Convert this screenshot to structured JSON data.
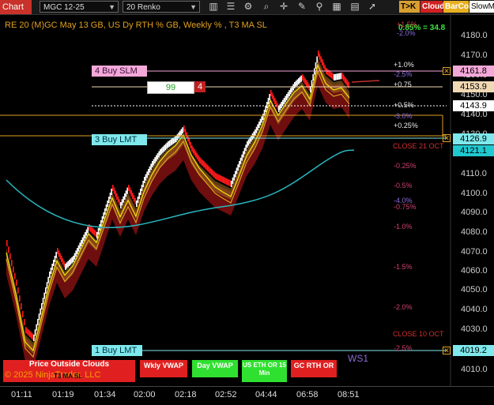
{
  "toolbar": {
    "tab_label": "Chart",
    "instrument": "MGC 12-25",
    "bar_type": "20 Renko",
    "tk_label": "T>K",
    "cloud_label": "Cloud",
    "barcol_label": "BarCol",
    "slowma_label": "SlowM",
    "icons": [
      "bar-chart-icon",
      "list-icon",
      "indicator-icon",
      "zoom-icon",
      "crosshair-icon",
      "plus-icon",
      "pencil-icon",
      "search-icon",
      "layout-icon"
    ]
  },
  "chart": {
    "title": "RE 20  (M)GC May 13 GB, US Dy RTH % GB, Weekly % , T3 MA SL",
    "stat_top": "0.85% = 34.8",
    "y_ticks": [
      "4180.0",
      "4170.0",
      "4160.0",
      "4150.0",
      "4140.0",
      "4130.0",
      "4120.0",
      "4110.0",
      "4100.0",
      "4090.0",
      "4080.0",
      "4070.0",
      "4060.0",
      "4050.0",
      "4040.0",
      "4030.0",
      "4020.0",
      "4010.0"
    ],
    "x_ticks": [
      "01:11",
      "01:19",
      "01:34",
      "02:00",
      "02:18",
      "02:52",
      "04:44",
      "06:58",
      "08:51"
    ],
    "price_boxes": [
      {
        "value": "4161.8",
        "bg": "#f4a8d8",
        "fg": "#000"
      },
      {
        "value": "4153.9",
        "bg": "#f1d9b5",
        "fg": "#000"
      },
      {
        "value": "4143.9",
        "bg": "#ffffff",
        "fg": "#000"
      },
      {
        "value": "4126.9",
        "bg": "#7ee8ec",
        "fg": "#000"
      },
      {
        "value": "4121.1",
        "bg": "#20c8d0",
        "fg": "#000"
      },
      {
        "value": "4019.2",
        "bg": "#7ee8ec",
        "fg": "#000"
      }
    ],
    "orders": {
      "buy_slm": "4 Buy SLM",
      "buy_lmt": "3 Buy LMT",
      "buy_lmt1": "1 Buy LMT",
      "qty_green": "99",
      "qty_red": "4"
    },
    "pct_labels": [
      {
        "text": "+1.5%",
        "color": "#d04040"
      },
      {
        "text": "-2.0%",
        "color": "#8a6ad8"
      },
      {
        "text": "+1.0%",
        "color": "#e8e8e8"
      },
      {
        "text": "-2.5%",
        "color": "#8a6ad8"
      },
      {
        "text": "+0.75",
        "color": "#e8e8e8"
      },
      {
        "text": "+0.5%",
        "color": "#e8e8e8"
      },
      {
        "text": "-3.0%",
        "color": "#8a6ad8"
      },
      {
        "text": "+0.25%",
        "color": "#e8e8e8"
      },
      {
        "text": "CLOSE 21 OCT",
        "color": "#d03030"
      },
      {
        "text": "-0.25%",
        "color": "#d04070"
      },
      {
        "text": "-0.5%",
        "color": "#d04070"
      },
      {
        "text": "-4.0%",
        "color": "#8a6ad8"
      },
      {
        "text": "-0.75%",
        "color": "#d04070"
      },
      {
        "text": "-1.0%",
        "color": "#d04070"
      },
      {
        "text": "-1.5%",
        "color": "#d04070"
      },
      {
        "text": "-2.0%",
        "color": "#d04070"
      },
      {
        "text": "CLOSE 10 OCT",
        "color": "#d03030"
      },
      {
        "text": "-2.5%",
        "color": "#d04070"
      }
    ],
    "ws_label": "WS1",
    "copyright": "© 2025 NinjaTrader, LLC"
  },
  "indicators": {
    "price_outside": "Price Outside Clouds",
    "t3_ma": "T3 MA SL",
    "wkly_vwap": "Wkly VWAP",
    "day_vwap": "Day VWAP",
    "us_eth": "US ETH OR 15 Min",
    "gc_rth": "GC RTH OR"
  },
  "colors": {
    "up_bar": "#ffffff",
    "down_bar": "#ff1a1a",
    "cloud_dark": "#7a1010",
    "cloud_gold": "#a07020",
    "ma_yellow": "#f2e600",
    "ma_gold": "#d8a020",
    "vwap_cyan": "#2ab8c0",
    "accent_orange": "#e0a020"
  }
}
